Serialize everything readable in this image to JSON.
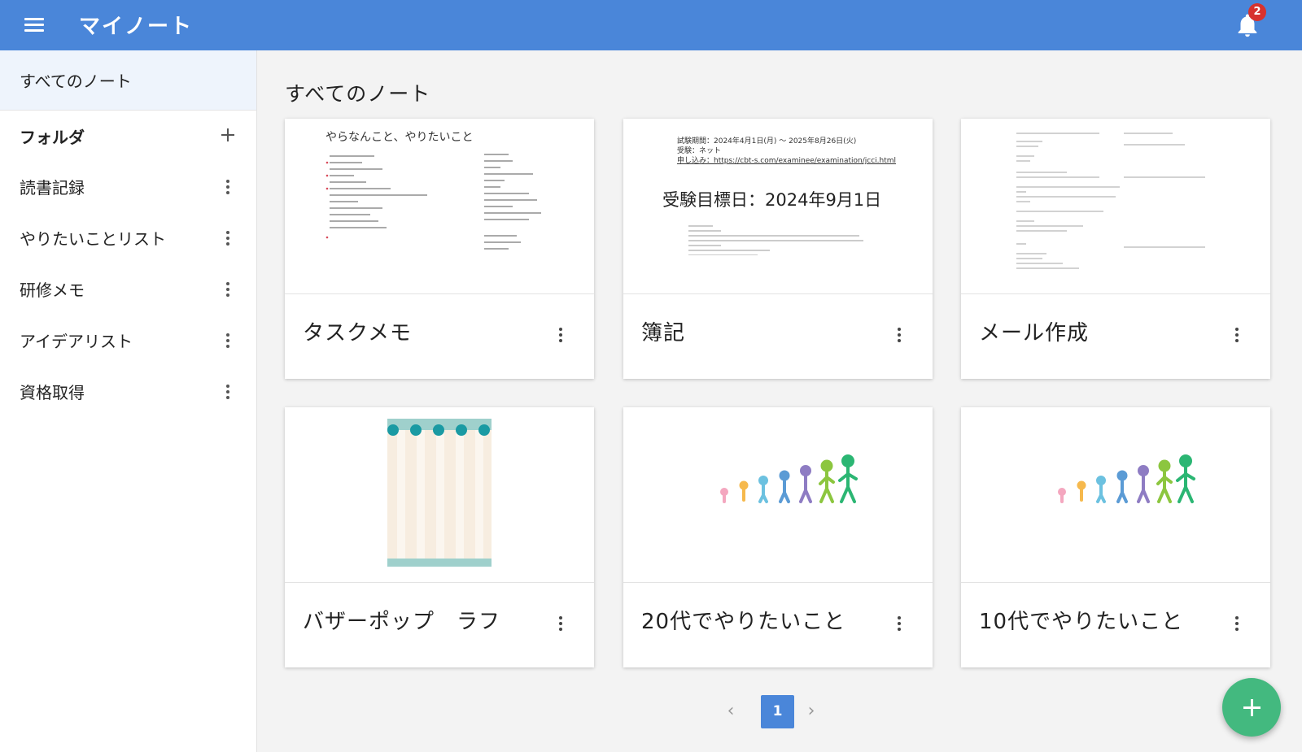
{
  "appbar": {
    "title": "マイノート",
    "notification_count": "2"
  },
  "sidebar": {
    "all_notes": "すべてのノート",
    "folder_header": "フォルダ",
    "folders": [
      "読書記録",
      "やりたいことリスト",
      "研修メモ",
      "アイデアリスト",
      "資格取得"
    ]
  },
  "main": {
    "title": "すべてのノート"
  },
  "notes": [
    {
      "title": "タスクメモ",
      "preview_heading": "やらなんこと、やりたいこと"
    },
    {
      "title": "簿記",
      "preview_line1": "試験期間：2024年4月1日(月) ～ 2025年8月26日(火)",
      "preview_line2": "受験：ネット",
      "preview_line3": "申し込み：https://cbt-s.com/examinee/examination/jcci.html",
      "preview_big": "受験目標日：2024年9月1日"
    },
    {
      "title": "メール作成"
    },
    {
      "title": "バザーポップ　ラフ"
    },
    {
      "title": "20代でやりたいこと"
    },
    {
      "title": "10代でやりたいこと"
    }
  ],
  "pagination": {
    "current": "1"
  },
  "colors": {
    "primary": "#4a86d9",
    "fab": "#43b97f",
    "badge": "#d7322e"
  }
}
